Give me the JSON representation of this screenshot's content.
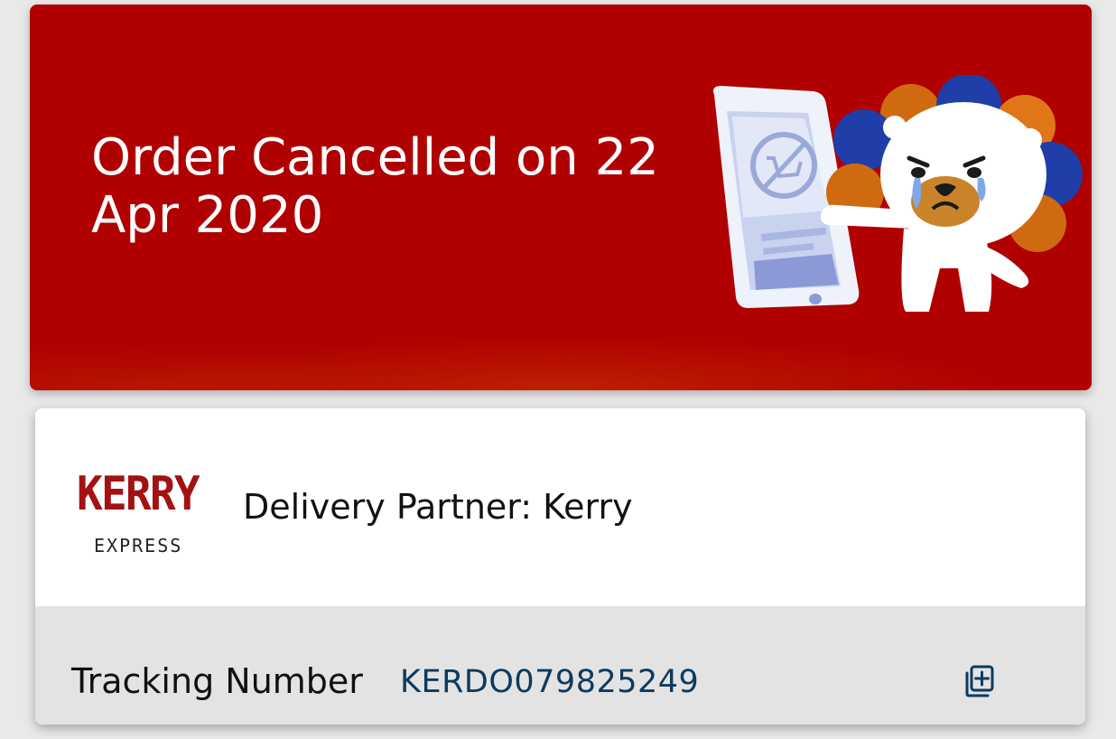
{
  "banner": {
    "title": "Order Cancelled on 22 Apr 2020",
    "background_color": "#b00000",
    "illustration": "crying-lion-mascot-with-phone-illustration"
  },
  "delivery": {
    "logo_text_main": "KERRY",
    "logo_text_sub": "EXPRESS",
    "partner_label": "Delivery Partner: Kerry",
    "tracking_label": "Tracking Number",
    "tracking_number": "KERDO079825249",
    "copy_icon": "copy-plus-icon",
    "tracking_color": "#0e3a5e",
    "logo_color": "#a31212"
  }
}
